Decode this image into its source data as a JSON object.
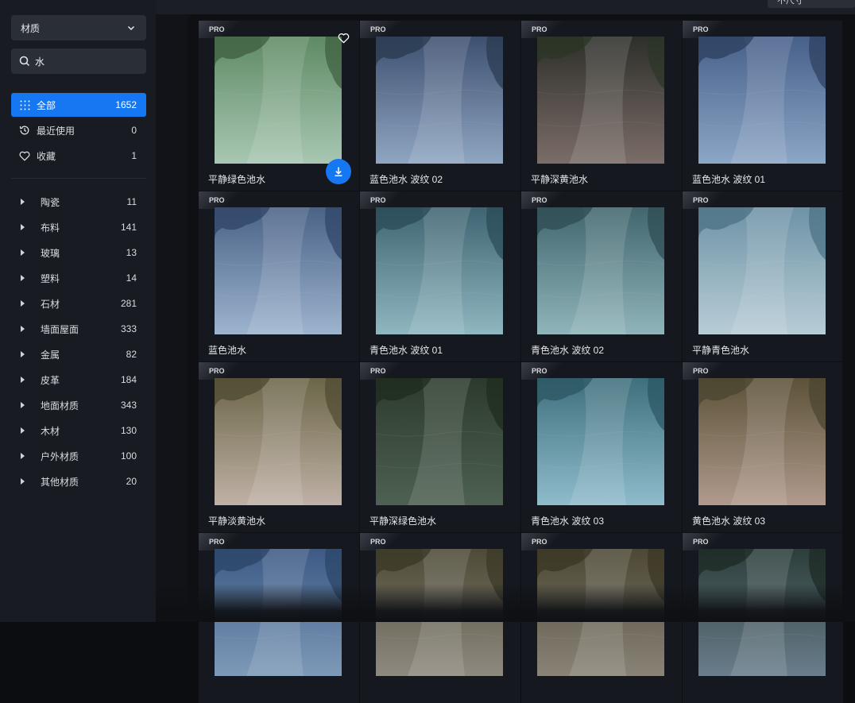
{
  "sidebar": {
    "material_select": "材质",
    "search": {
      "value": "水"
    },
    "nav": [
      {
        "label": "全部",
        "count": "1652",
        "icon": "grid-dots-icon",
        "active": true
      },
      {
        "label": "最近使用",
        "count": "0",
        "icon": "history-icon",
        "active": false
      },
      {
        "label": "收藏",
        "count": "1",
        "icon": "heart-icon",
        "active": false
      }
    ],
    "categories": [
      {
        "label": "陶瓷",
        "count": "11"
      },
      {
        "label": "布料",
        "count": "141"
      },
      {
        "label": "玻璃",
        "count": "13"
      },
      {
        "label": "塑料",
        "count": "14"
      },
      {
        "label": "石材",
        "count": "281"
      },
      {
        "label": "墙面屋面",
        "count": "333"
      },
      {
        "label": "金属",
        "count": "82"
      },
      {
        "label": "皮革",
        "count": "184"
      },
      {
        "label": "地面材质",
        "count": "343"
      },
      {
        "label": "木材",
        "count": "130"
      },
      {
        "label": "户外材质",
        "count": "100"
      },
      {
        "label": "其他材质",
        "count": "20"
      }
    ]
  },
  "top": {
    "sort_label": "不尺寸"
  },
  "colors": {
    "accent": "#1677f2"
  },
  "grid": {
    "badge": "PRO",
    "items": [
      {
        "name": "平静绿色池水",
        "top": "#5f8a64",
        "bottom": "#a8c7b3",
        "tree": "#3d5e3f"
      },
      {
        "name": "蓝色池水 波纹 02",
        "top": "#3e5070",
        "bottom": "#8fa6c2",
        "tree": "#283a4e"
      },
      {
        "name": "平静深黄池水",
        "top": "#2e2f2a",
        "bottom": "#7b6d68",
        "tree": "#2b3626"
      },
      {
        "name": "蓝色池水 波纹 01",
        "top": "#47608a",
        "bottom": "#8ca6c6",
        "tree": "#2c3f5e"
      },
      {
        "name": "蓝色池水",
        "top": "#4a6286",
        "bottom": "#9db4cf",
        "tree": "#2f4466"
      },
      {
        "name": "青色池水 波纹 01",
        "top": "#3f6472",
        "bottom": "#8fb7c0",
        "tree": "#2a4a55"
      },
      {
        "name": "青色池水 波纹 02",
        "top": "#42666e",
        "bottom": "#8fb4b9",
        "tree": "#2d4b52"
      },
      {
        "name": "平静青色池水",
        "top": "#6e93a6",
        "bottom": "#b8cdd6",
        "tree": "#4c7084"
      },
      {
        "name": "平静淡黄池水",
        "top": "#6b6648",
        "bottom": "#c0b1a6",
        "tree": "#4e4a30"
      },
      {
        "name": "平静深绿色池水",
        "top": "#2c3a2c",
        "bottom": "#4e6152",
        "tree": "#1e2b1c"
      },
      {
        "name": "青色池水 波纹 03",
        "top": "#3f6f7c",
        "bottom": "#8fbccc",
        "tree": "#2b5562"
      },
      {
        "name": "黄色池水 波纹 03",
        "top": "#5c5238",
        "bottom": "#b09a8c",
        "tree": "#4a4430"
      },
      {
        "name": "",
        "top": "#3c5a86",
        "bottom": "#7e9ab8",
        "tree": "#2a4466"
      },
      {
        "name": "",
        "top": "#4d4a36",
        "bottom": "#8f8a80",
        "tree": "#3a3826"
      },
      {
        "name": "",
        "top": "#4c4834",
        "bottom": "#8a8478",
        "tree": "#3a3624"
      },
      {
        "name": "",
        "top": "#2c3e3a",
        "bottom": "#6a7e8c",
        "tree": "#1c2a24"
      }
    ]
  }
}
